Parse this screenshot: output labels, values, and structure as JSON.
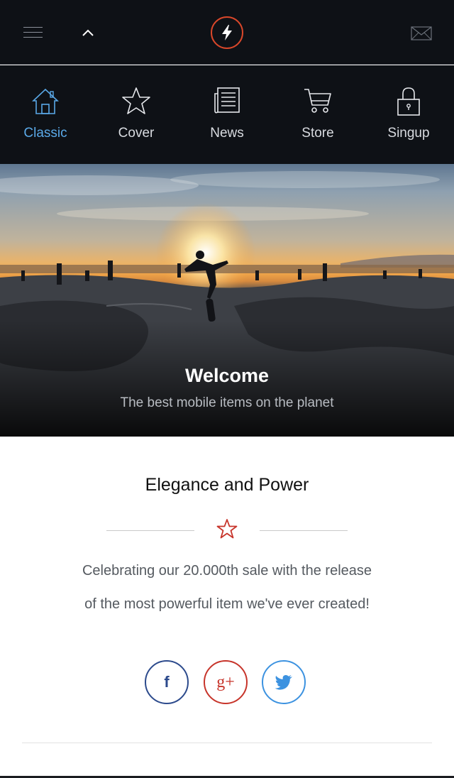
{
  "topbar": {
    "menu_icon": "hamburger-menu-icon",
    "collapse_icon": "chevron-up-icon",
    "logo_icon": "lightning-bolt-icon",
    "mail_icon": "envelope-icon",
    "accent": "#d9472a"
  },
  "nav": {
    "items": [
      {
        "label": "Classic",
        "icon": "home-icon",
        "active": true
      },
      {
        "label": "Cover",
        "icon": "star-icon",
        "active": false
      },
      {
        "label": "News",
        "icon": "newspaper-icon",
        "active": false
      },
      {
        "label": "Store",
        "icon": "cart-icon",
        "active": false
      },
      {
        "label": "Singup",
        "icon": "lock-icon",
        "active": false
      }
    ],
    "active_color": "#5aa9e8"
  },
  "hero": {
    "title": "Welcome",
    "subtitle": "The best mobile items on the planet"
  },
  "section": {
    "title": "Elegance and Power",
    "divider_icon": "star-icon",
    "paragraph_line1": "Celebrating our 20.000th sale with the release",
    "paragraph_line2": "of the most powerful item we've ever created!"
  },
  "social": {
    "facebook": {
      "glyph": "f",
      "icon": "facebook-icon",
      "color": "#2c4a8c"
    },
    "googleplus": {
      "glyph": "g+",
      "icon": "google-plus-icon",
      "color": "#c7342a"
    },
    "twitter": {
      "icon": "twitter-icon",
      "color": "#3c92e0"
    }
  }
}
